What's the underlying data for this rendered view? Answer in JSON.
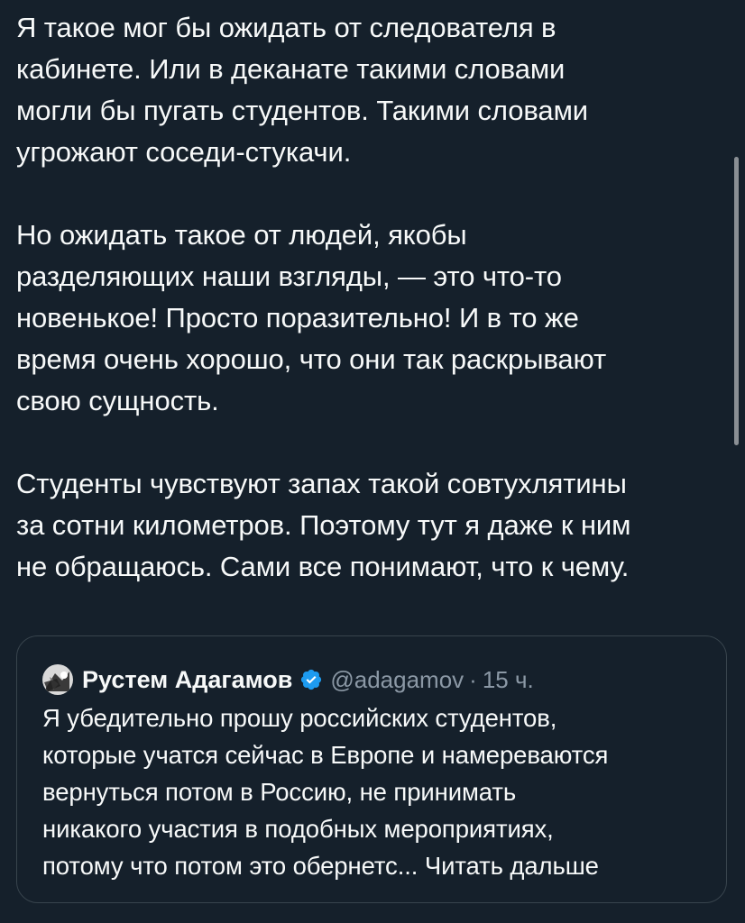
{
  "tweet": {
    "paragraphs": [
      [
        "Я такое мог бы ожидать от следователя в",
        "кабинете. Или в деканате такими словами",
        "могли бы пугать студентов. Такими словами",
        "угрожают соседи-стукачи."
      ],
      [
        "Но ожидать такое от людей, якобы",
        "разделяющих наши взгляды, — это что-то",
        "новенькое! Просто поразительно! И в то же",
        "время очень хорошо, что они так раскрывают",
        "свою сущность."
      ],
      [
        "Студенты чувствуют запах такой совтухлятины",
        "за сотни километров. Поэтому тут я даже к ним",
        "не обращаюсь. Сами все понимают, что к чему."
      ]
    ]
  },
  "quote": {
    "author_name": "Рустем Адагамов",
    "handle": "@adagamov",
    "separator": "·",
    "time": "15 ч.",
    "verified_icon": "verified-badge-icon",
    "verified_color": "#1d9bf0",
    "text_lines": [
      "Я убедительно прошу российских студентов,",
      "которые учатся сейчас в Европе и намереваются",
      "вернуться потом в Россию, не принимать",
      "никакого участия в подобных мероприятиях,",
      "потому что потом это обернетс..."
    ],
    "read_more": "Читать дальше"
  },
  "colors": {
    "background": "#15202b",
    "text": "#f7f9f9",
    "secondary_text": "#8b98a5",
    "border": "#38444d"
  }
}
